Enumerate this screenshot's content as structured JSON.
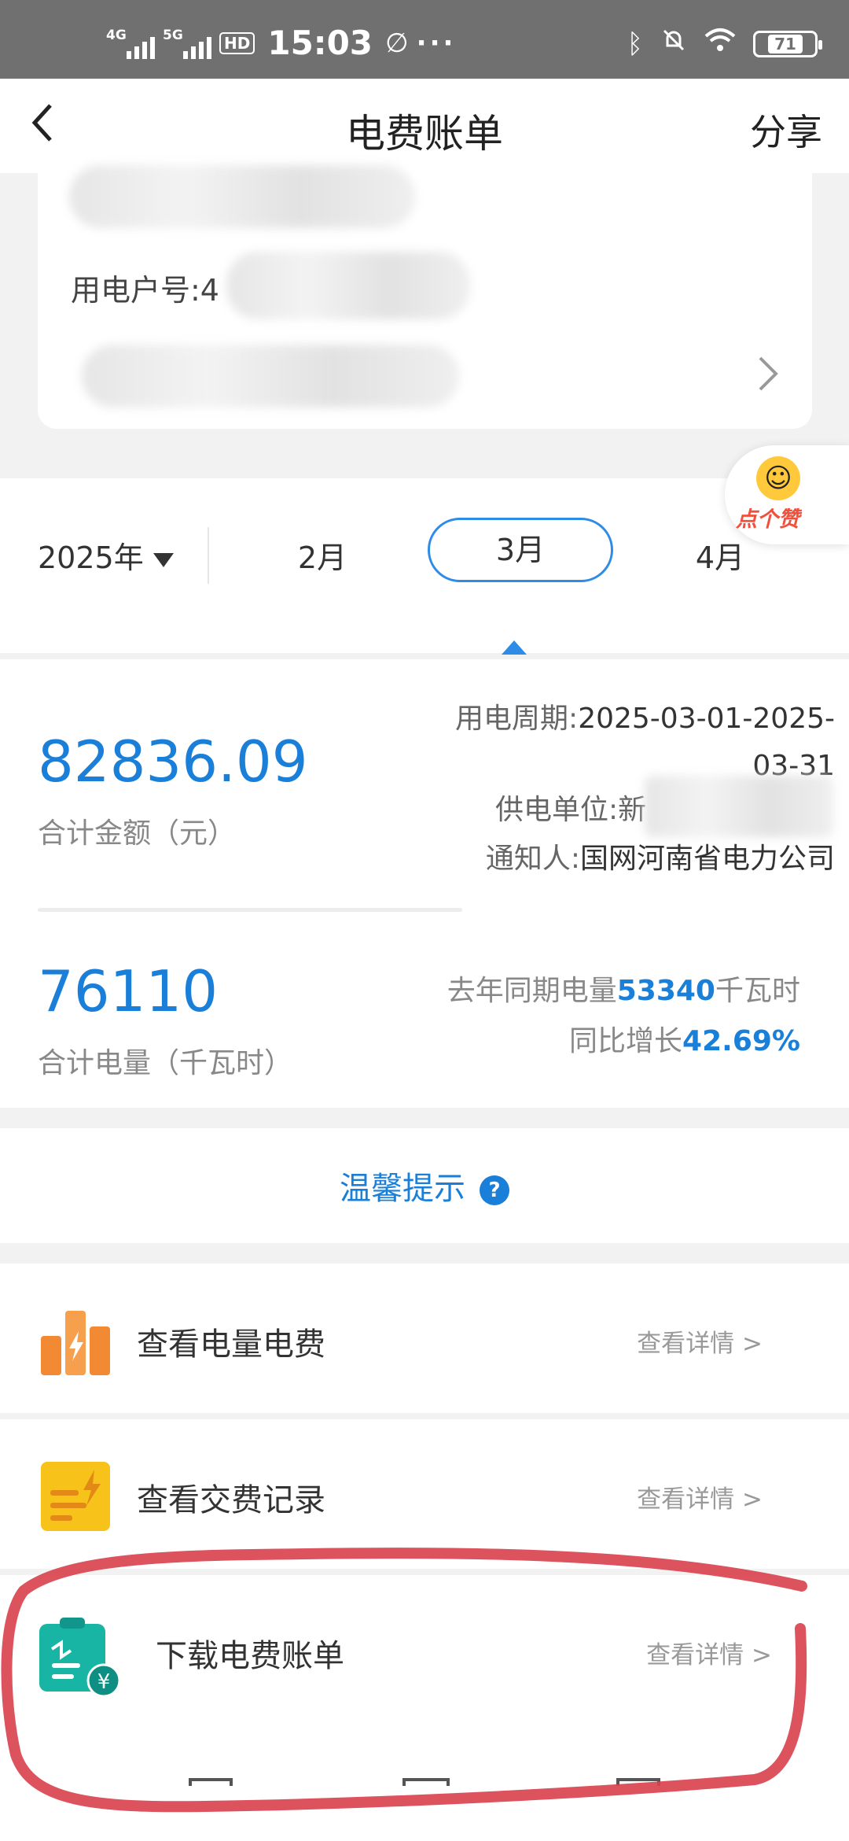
{
  "status_bar": {
    "net1": "4G",
    "net2": "5G",
    "hd": "HD",
    "time": "15:03",
    "dots": "···",
    "battery": "71"
  },
  "header": {
    "title": "电费账单",
    "share": "分享"
  },
  "user_card": {
    "account_label": "用电户号:4"
  },
  "month_selector": {
    "year": "2025年",
    "months": [
      "2月",
      "3月",
      "4月"
    ],
    "selected": "3月"
  },
  "floating_button": {
    "label": "点个赞"
  },
  "summary": {
    "amount": "82836.09",
    "amount_label": "合计金额（元）",
    "period_label": "用电周期:",
    "period_value_line1": "2025-03-01-2025-",
    "period_value_line2": "03-31",
    "supplier_label": "供电单位:新",
    "notifier_label": "通知人:",
    "notifier_value": "国网河南省电力公司",
    "kwh": "76110",
    "kwh_label": "合计电量（千瓦时）",
    "lastyear_prefix": "去年同期电量",
    "lastyear_value": "53340",
    "lastyear_unit": "千瓦时",
    "yoy_prefix": "同比增长",
    "yoy_value": "42.69%"
  },
  "tip": {
    "label": "温馨提示",
    "icon": "?"
  },
  "list": [
    {
      "label": "查看电量电费",
      "more": "查看详情 >",
      "icon": "bar-chart-icon"
    },
    {
      "label": "查看交费记录",
      "more": "查看详情 >",
      "icon": "payment-record-icon"
    },
    {
      "label": "下载电费账单",
      "more": "查看详情 >",
      "icon": "bill-download-icon"
    }
  ],
  "colors": {
    "accent": "#1a7fd8",
    "annotation": "#d9434f"
  }
}
